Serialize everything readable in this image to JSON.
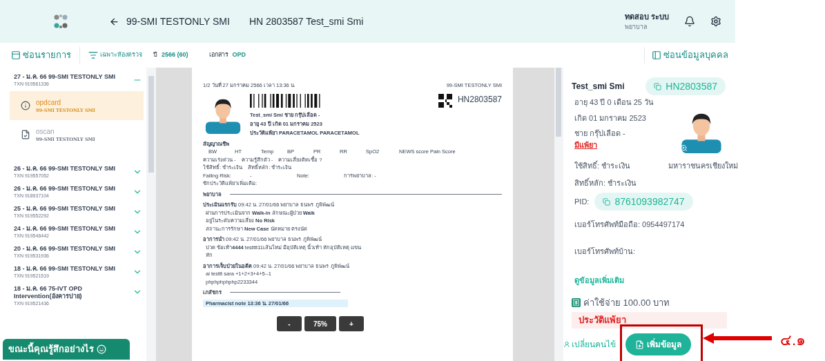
{
  "header": {
    "title": "99-SMI TESTONLY SMI",
    "patient": "HN 2803587 Test_smi Smi",
    "user_name": "ทดสอบ ระบบ",
    "user_role": "พยาบาล"
  },
  "toolbar": {
    "hide_list": "ซ่อนรายการ",
    "filter": "เฉพาะห้องตรวจ",
    "year_label": "ปี",
    "year_value": "2566 (60)",
    "doc_label": "เอกสาร",
    "doc_value": "OPD",
    "hide_person": "ซ่อนข้อมูลบุคคล"
  },
  "visits": [
    {
      "title": "27 - ม.ค. 66 99-SMI TESTONLY SMI",
      "txn": "TXN 919561336",
      "expanded": true,
      "children": [
        {
          "kind": "info",
          "name": "opdcard",
          "subtitle": "99-SMI TESTONLY SMI",
          "selected": true
        },
        {
          "kind": "scan",
          "name": "oscan",
          "subtitle": "99-SMI TESTONLY SMI",
          "selected": false
        }
      ]
    },
    {
      "title": "26 - ม.ค. 66 99-SMI TESTONLY SMI",
      "txn": "TXN 919557052",
      "expanded": false
    },
    {
      "title": "26 - ม.ค. 66 99-SMI TESTONLY SMI",
      "txn": "TXN 918937104",
      "expanded": false
    },
    {
      "title": "25 - ม.ค. 66 99-SMI TESTONLY SMI",
      "txn": "TXN 919552292",
      "expanded": false
    },
    {
      "title": "24 - ม.ค. 66 99-SMI TESTONLY SMI",
      "txn": "TXN 919546442",
      "expanded": false
    },
    {
      "title": "20 - ม.ค. 66 99-SMI TESTONLY SMI",
      "txn": "TXN 919531936",
      "expanded": false
    },
    {
      "title": "18 - ม.ค. 66 99-SMI TESTONLY SMI",
      "txn": "TXN 919521519",
      "expanded": false
    },
    {
      "title": "18 - ม.ค. 66 75-IVT OPD Intervention(อังคารบ่าย)",
      "txn": "TXN 919521436",
      "expanded": false
    }
  ],
  "feedback": "ขณะนี้คุณรู้สึกอย่างไร",
  "document": {
    "page_info": "1/2  วันที่ 27 มกราคม 2566  เวลา 13:36 น.",
    "clinic": "99-SMI TESTONLY SMI",
    "hn": "HN2803587",
    "patient_lines": [
      "Test_smi Smi   ชาย   กรุ๊ปเลือด -",
      "อายุ 43 ปี   เกิด 01 มกราคม 2523",
      "ประวัติแพ้ยา PARACETAMOL PARACETAMOL"
    ],
    "vitals_title": "สัญญาณชีพ",
    "vitals": [
      "BW",
      "HT",
      "Temp",
      "BP",
      "PR",
      "RR",
      "SpO2",
      "NEWS score Pain Score"
    ],
    "info_rows": [
      [
        "ความเร่งด่วน -",
        "ความรู้สึกตัว -",
        "ความเสี่ยงติดเชื้อ ?"
      ],
      [
        "ใช้สิทธิ์: ชำระเงิน",
        "สิทธิ์หลัก: ชำระเงิน"
      ],
      [
        "Falling Risk:",
        "-",
        "Note:",
        "การพยาบาล: -"
      ],
      [
        "ซักประวัติแพ้ยาเพิ่มเติม:"
      ]
    ],
    "sections": [
      {
        "title": "พยาบาล",
        "entries": [
          {
            "heading": "**ประเมินแรกรับ** 09:42 น. 27/01/66 พยาบาล ธนพร ภูพิพัฒน์",
            "lines": [
              "ผ่านการประเมินจาก **Walk-in**  ลักษณะผู้ป่วย **Walk**",
              "อยู่ในระดับความเสี่ยง **No Risk**",
              "สถานะการรักษา **New Case**  นัดหมาย ตรงนัด"
            ]
          },
          {
            "heading": "**อาการนำ** 09:42 น. 27/01/66 พยาบาล ธนพร ภูพิพัฒน์",
            "lines": [
              "ปวด ข้อเท้า**4444** testttt11เส้นใหม่ มีอุบัติเหตุ นิ้วเท้า หักอุบัติเหตุ แขน",
              "หัก"
            ]
          },
          {
            "heading": "**อาการเจ็บป่วยในอดีต** 09:42 น. 27/01/66 พยาบาล ธนพร ภูพิพัฒน์",
            "lines": [
              "ai testtt sara +1+2+3+4+5--1",
              "phphphphphp2233344"
            ]
          }
        ]
      },
      {
        "title": "เภสัชกร",
        "note": "Pharmacist note 13:36 น. 27/01/66"
      }
    ]
  },
  "zoom_controls": {
    "minus": "-",
    "value": "75%",
    "plus": "+"
  },
  "patient": {
    "name": "Test_smi Smi",
    "hn": "HN2803587",
    "age": "อายุ 43 ปี 0 เดือน 25 วัน",
    "birth": "เกิด 01 มกราคม 2523",
    "gender": "ชาย กรุ๊ปเลือด -",
    "allergy_link": "มีแพ้ยา",
    "right": "ใช้สิทธิ์: ชำระเงิน",
    "hospital": "มหาราชนครเชียงใหม่",
    "main_right": "สิทธิ์หลัก: ชำระเงิน",
    "pid_label": "PID:",
    "pid": "8761093982747",
    "mobile": "เบอร์โทรศัพท์มือถือ: 0954497174",
    "home_phone": "เบอร์โทรศัพท์บ้าน:",
    "more": "ดูข้อมูลเพิ่มเติม",
    "cost": "ค่าใช้จ่าย 100.00 บาท",
    "allergy_history": "ประวัติแพ้ยา",
    "change_patient": "เปลี่ยนคนไข้",
    "add_button": "เพิ่มข้อมูล"
  },
  "annotation": {
    "label": "๔.๑"
  }
}
